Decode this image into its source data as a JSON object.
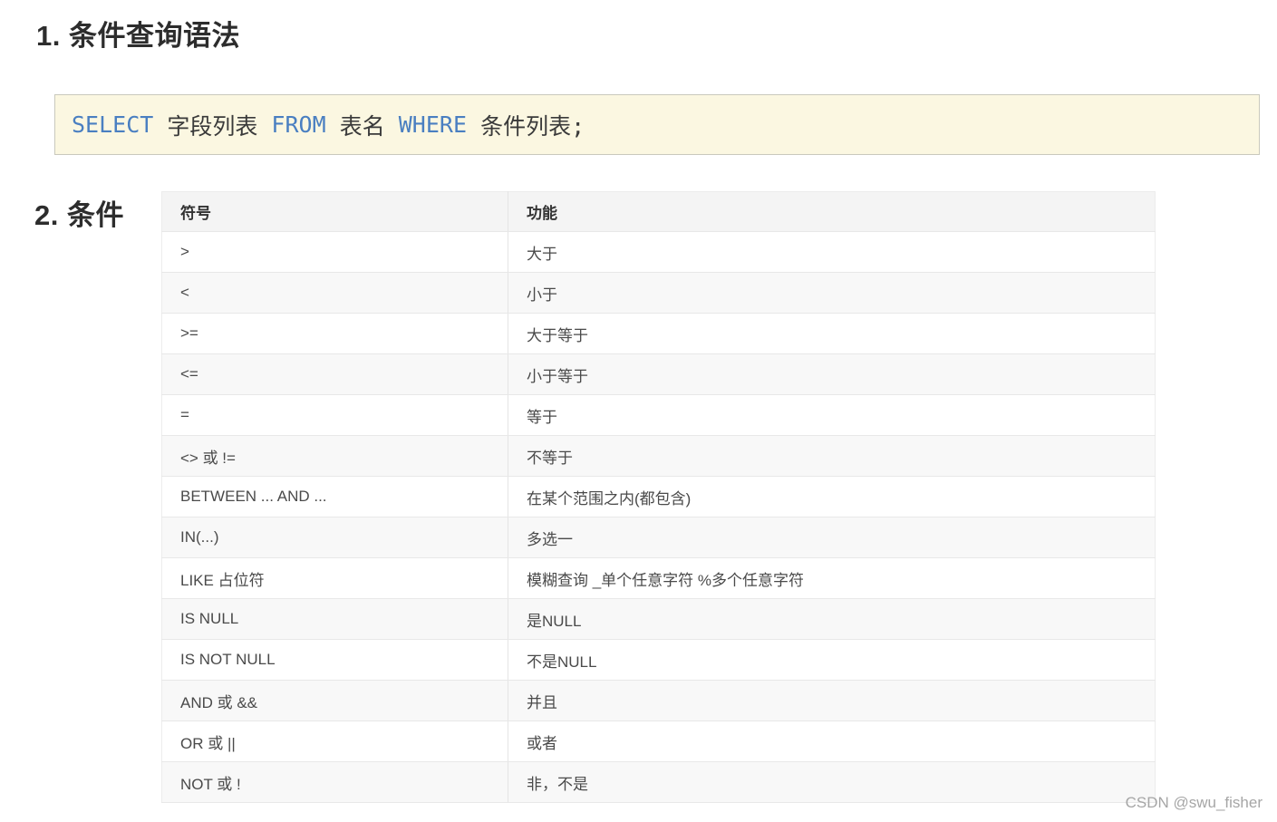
{
  "page": {
    "watermark": "CSDN @swu_fisher"
  },
  "colors": {
    "keyword_blue": "#4a7fc1",
    "code_background": "#fbf7e1",
    "code_border": "#c9c9bd",
    "table_header_background": "#f4f4f4",
    "table_stripe_background": "#f8f8f8"
  },
  "sections": [
    {
      "title": "1. 条件查询语法"
    },
    {
      "title": "2. 条件"
    }
  ],
  "code": {
    "parts": [
      {
        "text": "SELECT",
        "type": "keyword"
      },
      {
        "text": " 字段列表 ",
        "type": "plain"
      },
      {
        "text": "FROM",
        "type": "keyword"
      },
      {
        "text": " 表名 ",
        "type": "plain"
      },
      {
        "text": "WHERE",
        "type": "keyword"
      },
      {
        "text": " 条件列表;",
        "type": "plain"
      }
    ]
  },
  "condition_table": {
    "columns": [
      "符号",
      "功能"
    ],
    "rows": [
      {
        "symbol": ">",
        "function": "大于"
      },
      {
        "symbol": "<",
        "function": "小于"
      },
      {
        "symbol": ">=",
        "function": "大于等于"
      },
      {
        "symbol": "<=",
        "function": "小于等于"
      },
      {
        "symbol": "=",
        "function": "等于"
      },
      {
        "symbol": "<> 或 !=",
        "function": "不等于"
      },
      {
        "symbol": "BETWEEN ... AND ...",
        "function": "在某个范围之内(都包含)"
      },
      {
        "symbol": "IN(...)",
        "function": "多选一"
      },
      {
        "symbol": "LIKE 占位符",
        "function": "模糊查询 _单个任意字符  %多个任意字符"
      },
      {
        "symbol": "IS NULL",
        "function": "是NULL"
      },
      {
        "symbol": "IS NOT NULL",
        "function": "不是NULL"
      },
      {
        "symbol": "AND 或 &&",
        "function": "并且"
      },
      {
        "symbol": "OR 或 ||",
        "function": "或者"
      },
      {
        "symbol": "NOT 或 !",
        "function": "非，不是"
      }
    ]
  }
}
